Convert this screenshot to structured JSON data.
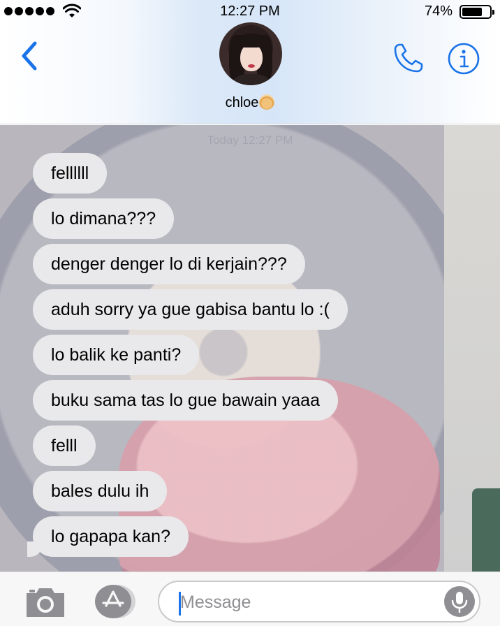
{
  "status_bar": {
    "time": "12:27 PM",
    "battery_percent": "74%",
    "battery_level": 0.74,
    "signal_bars": 5
  },
  "header": {
    "contact_name": "chloe",
    "contact_emoji": "person-emoji",
    "back_icon": "chevron-left-icon",
    "phone_icon": "phone-icon",
    "info_icon": "info-icon",
    "accent_color": "#1a73e8"
  },
  "chat": {
    "timestamp": "Today 12:27 PM",
    "messages": [
      {
        "text": "fellllll",
        "direction": "incoming"
      },
      {
        "text": "lo dimana???",
        "direction": "incoming"
      },
      {
        "text": "denger denger lo di kerjain???",
        "direction": "incoming"
      },
      {
        "text": "aduh sorry ya gue gabisa bantu lo :(",
        "direction": "incoming"
      },
      {
        "text": "lo balik ke panti?",
        "direction": "incoming"
      },
      {
        "text": "buku sama tas lo gue bawain yaaa",
        "direction": "incoming"
      },
      {
        "text": "felll",
        "direction": "incoming"
      },
      {
        "text": "bales dulu ih",
        "direction": "incoming"
      },
      {
        "text": "lo gapapa kan?",
        "direction": "incoming"
      }
    ],
    "bubble_color": "#e9e9eb"
  },
  "input_bar": {
    "placeholder": "Message",
    "value": "",
    "camera_icon": "camera-icon",
    "apps_icon": "app-store-icon",
    "mic_icon": "microphone-icon"
  }
}
